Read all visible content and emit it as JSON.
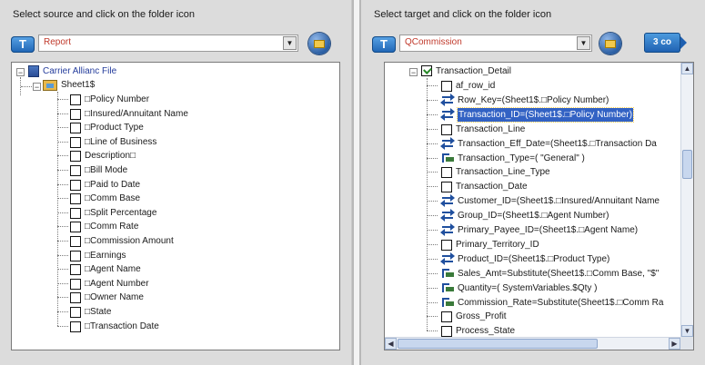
{
  "source": {
    "instruction": "Select source and click on the folder icon",
    "type_button": "T",
    "selected": "Report",
    "tree": {
      "root_label": "Carrier Allianc File",
      "sheet_label": "Sheet1$",
      "fields": [
        "□Policy Number",
        "□Insured/Annuitant Name",
        "□Product Type",
        "□Line of Business",
        "Description□",
        "□Bill Mode",
        "□Paid to Date",
        "□Comm Base",
        "□Split Percentage",
        "□Comm Rate",
        "□Commission Amount",
        "□Earnings",
        "□Agent Name",
        "□Agent Number",
        "□Owner Name",
        "□State",
        "□Transaction Date"
      ]
    }
  },
  "target": {
    "instruction": "Select target and click on the folder icon",
    "type_button": "T",
    "selected": "QCommission",
    "go_button": "3 co",
    "tree": {
      "root_label": "Transaction_Detail",
      "fields": [
        {
          "label": "af_row_id",
          "icon": "checkbox"
        },
        {
          "label": "Row_Key=(Sheet1$.□Policy Number)",
          "icon": "map"
        },
        {
          "label": "Transaction_ID=(Sheet1$.□Policy Number)",
          "icon": "map",
          "selected": true
        },
        {
          "label": "Transaction_Line",
          "icon": "checkbox"
        },
        {
          "label": "Transaction_Eff_Date=(Sheet1$.□Transaction Da",
          "icon": "map"
        },
        {
          "label": "Transaction_Type=( \"General\" )",
          "icon": "func"
        },
        {
          "label": "Transaction_Line_Type",
          "icon": "checkbox"
        },
        {
          "label": "Transaction_Date",
          "icon": "checkbox"
        },
        {
          "label": "Customer_ID=(Sheet1$.□Insured/Annuitant Name",
          "icon": "map"
        },
        {
          "label": "Group_ID=(Sheet1$.□Agent Number)",
          "icon": "map"
        },
        {
          "label": "Primary_Payee_ID=(Sheet1$.□Agent Name)",
          "icon": "map"
        },
        {
          "label": "Primary_Territory_ID",
          "icon": "checkbox"
        },
        {
          "label": "Product_ID=(Sheet1$.□Product Type)",
          "icon": "map"
        },
        {
          "label": "Sales_Amt=Substitute(Sheet1$.□Comm Base, \"$\"",
          "icon": "func"
        },
        {
          "label": "Quantity=( SystemVariables.$Qty )",
          "icon": "func"
        },
        {
          "label": "Commission_Rate=Substitute(Sheet1$.□Comm Ra",
          "icon": "func"
        },
        {
          "label": "Gross_Profit",
          "icon": "checkbox"
        },
        {
          "label": "Process_State",
          "icon": "checkbox"
        }
      ]
    }
  },
  "colors": {
    "panel_bg": "#dcdcdc",
    "selection": "#3262c4",
    "select_text": "#c0392b",
    "root_text": "#243c9c"
  }
}
